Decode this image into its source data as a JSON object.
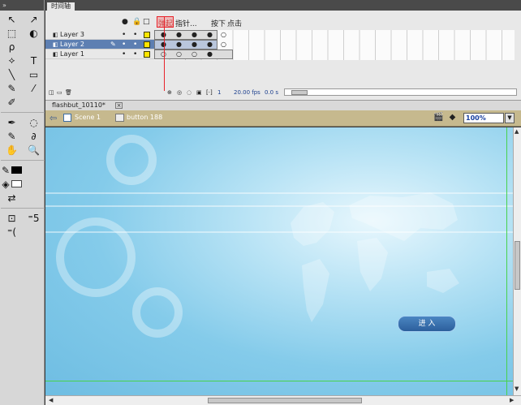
{
  "tools": {
    "header": "»",
    "items": [
      "↖",
      "↗",
      "⬚",
      "◐",
      "ρ",
      "",
      "⟡",
      "T",
      "╲",
      "▭",
      "✎",
      "⁄",
      "✐",
      "",
      "✒",
      "◌",
      "✎",
      "∂",
      "✋",
      "🔍"
    ],
    "extra": [
      "⊡",
      "⁼5",
      "⁼("
    ]
  },
  "timeline": {
    "tab_label": "时间轴",
    "header_icons": [
      "●",
      "🔒",
      "□"
    ],
    "frame_labels": [
      "弹起",
      "指针...",
      "按下",
      "点击"
    ],
    "layers": [
      {
        "name": "Layer 3",
        "selected": false
      },
      {
        "name": "Layer 2",
        "selected": true
      },
      {
        "name": "Layer 1",
        "selected": false
      }
    ],
    "bottom": {
      "frame_no": "1",
      "fps": "20.00 fps",
      "time": "0.0 s"
    }
  },
  "document": {
    "tab_label": "flashbut_10110*",
    "close": "×"
  },
  "editbar": {
    "scene": "Scene 1",
    "symbol": "button 188",
    "zoom": "100%"
  },
  "stage": {
    "button_label": "进 入"
  }
}
